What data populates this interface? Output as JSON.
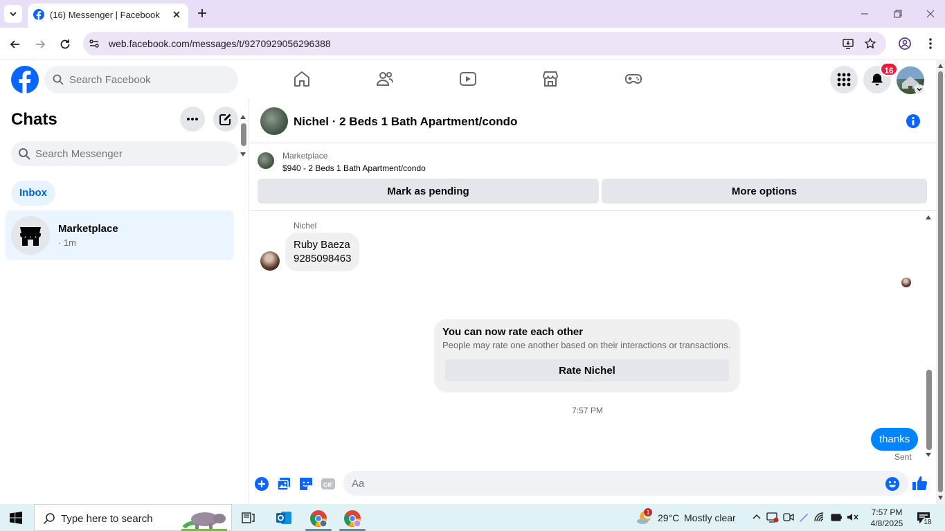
{
  "browser": {
    "tab_title": "(16) Messenger | Facebook",
    "url": "web.facebook.com/messages/t/9270929056296388"
  },
  "fb_header": {
    "search_placeholder": "Search Facebook",
    "notification_count": "16",
    "nav_icons": [
      "home-icon",
      "friends-icon",
      "video-icon",
      "marketplace-icon",
      "gaming-icon"
    ],
    "brand_color": "#0866ff"
  },
  "chats": {
    "title": "Chats",
    "search_placeholder": "Search Messenger",
    "inbox_label": "Inbox",
    "items": [
      {
        "name": "Marketplace",
        "time": "· 1m"
      }
    ]
  },
  "conversation": {
    "title": "Nichel · 2 Beds 1 Bath Apartment/condo",
    "listing": {
      "source": "Marketplace",
      "title": "$940 - 2 Beds 1 Bath Apartment/condo",
      "pending_label": "Mark as pending",
      "more_label": "More options"
    },
    "messages": {
      "sender_name": "Nichel",
      "incoming_line1": "Ruby Baeza",
      "incoming_line2": "9285098463",
      "rate_title": "You can now rate each other",
      "rate_desc": "People may rate one another based on their interactions or transactions.",
      "rate_button": "Rate Nichel",
      "time": "7:57 PM",
      "outgoing_text": "thanks",
      "outgoing_status": "Sent",
      "outgoing_color": "#0084ff"
    },
    "composer": {
      "placeholder": "Aa"
    }
  },
  "taskbar": {
    "search_placeholder": "Type here to search",
    "weather_badge": "1",
    "temperature": "29°C",
    "weather": "Mostly clear",
    "time": "7:57 PM",
    "date": "4/8/2025",
    "notification_count": "18"
  }
}
